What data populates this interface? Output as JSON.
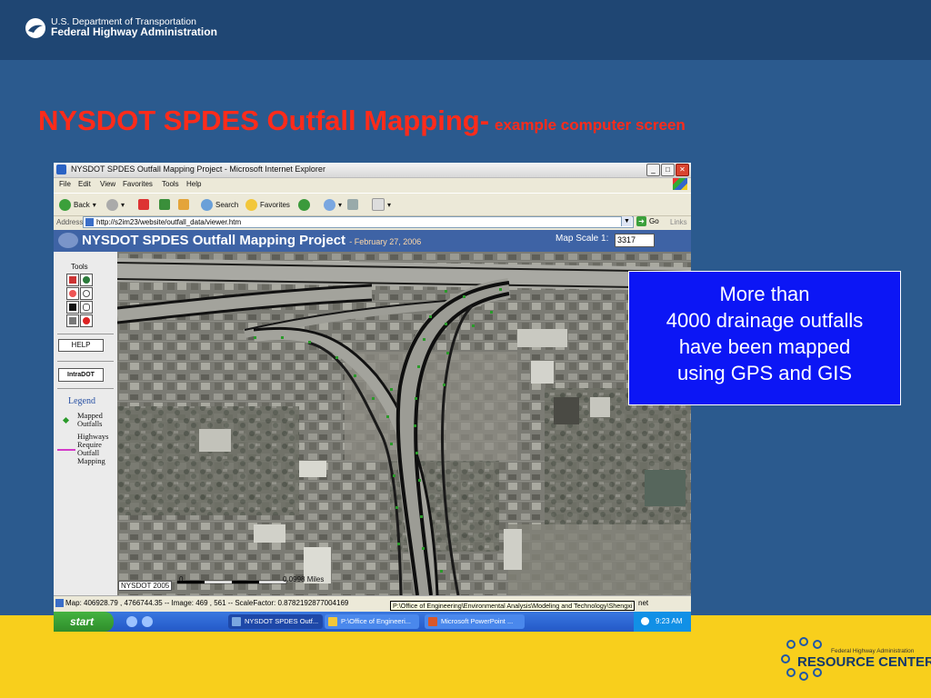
{
  "header": {
    "org_line1": "U.S. Department of Transportation",
    "org_line2": "Federal Highway Administration"
  },
  "slide": {
    "title": "NYSDOT SPDES Outfall Mapping-",
    "subtitle": "example computer screen"
  },
  "browser": {
    "window_title": "NYSDOT SPDES Outfall Mapping Project - Microsoft Internet Explorer",
    "menu": [
      "File",
      "Edit",
      "View",
      "Favorites",
      "Tools",
      "Help"
    ],
    "toolbar": {
      "back": "Back",
      "search": "Search",
      "favorites": "Favorites"
    },
    "address_label": "Address",
    "address_value": "http://s2im23/website/outfall_data/viewer.htm",
    "go": "Go",
    "links": "Links"
  },
  "app": {
    "title": "NYSDOT SPDES Outfall Mapping Project",
    "date": "- February 27, 2006",
    "scale_label": "Map Scale 1:",
    "scale_value": "3317",
    "tools_label": "Tools",
    "help_button": "HELP",
    "intradot_button": "IntraDOT",
    "legend_title": "Legend",
    "legend": [
      {
        "label": "Mapped Outfalls",
        "color": "#2a9a2a"
      },
      {
        "label": "Highways Require Outfall Mapping",
        "color": "#d33ac9"
      }
    ],
    "map_credit": "NYSDOT 2005",
    "scalebar_zero": "0",
    "scalebar_label": "0.0998 Miles"
  },
  "status": {
    "text": "Map: 406928.79 , 4766744.35 -- Image: 469 , 561 -- ScaleFactor: 0.8782192877004169",
    "tooltip": "P:\\Office of Engineering\\Environmental Analysis\\Modeling and Technology\\Shengxi",
    "zone": "net"
  },
  "taskbar": {
    "start": "start",
    "tasks": [
      "NYSDOT SPDES Outf...",
      "P:\\Office of Engineeri...",
      "Microsoft PowerPoint ..."
    ],
    "clock": "9:23 AM"
  },
  "callout": {
    "lines": [
      "More than",
      "4000 drainage outfalls",
      "have been mapped",
      "using GPS and GIS"
    ]
  },
  "footer": {
    "brand_small": "Federal Highway Administration",
    "brand_big": "RESOURCE CENTER"
  },
  "colors": {
    "slide_bg": "#2b5a8e",
    "title_red": "#ff2b1a",
    "band_yellow": "#f8cf1c",
    "callout_blue": "#0c16f5",
    "outfall_green": "#2a9a2a",
    "highway_magenta": "#d33ac9"
  }
}
